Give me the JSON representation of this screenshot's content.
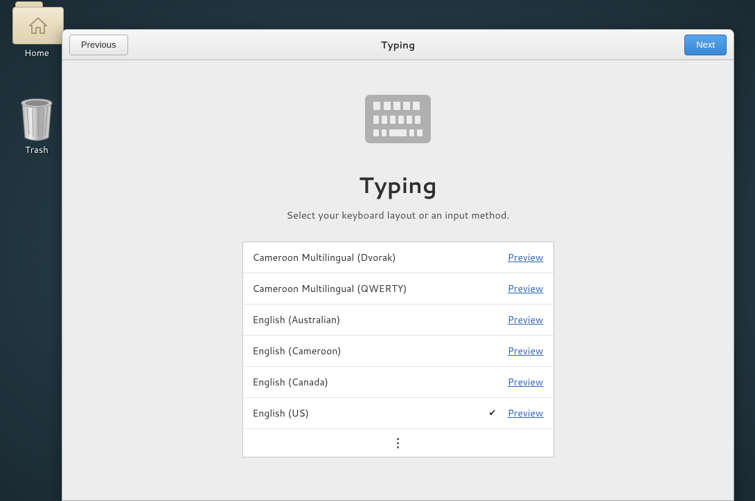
{
  "desktop": {
    "home_label": "Home",
    "trash_label": "Trash"
  },
  "dialog": {
    "previous_label": "Previous",
    "next_label": "Next",
    "title": "Typing",
    "heading": "Typing",
    "subtitle": "Select your keyboard layout or an input method.",
    "preview_label": "Preview",
    "layouts": [
      {
        "name": "Cameroon Multilingual (Dvorak)",
        "selected": false
      },
      {
        "name": "Cameroon Multilingual (QWERTY)",
        "selected": false
      },
      {
        "name": "English (Australian)",
        "selected": false
      },
      {
        "name": "English (Cameroon)",
        "selected": false
      },
      {
        "name": "English (Canada)",
        "selected": false
      },
      {
        "name": "English (US)",
        "selected": true
      }
    ]
  }
}
